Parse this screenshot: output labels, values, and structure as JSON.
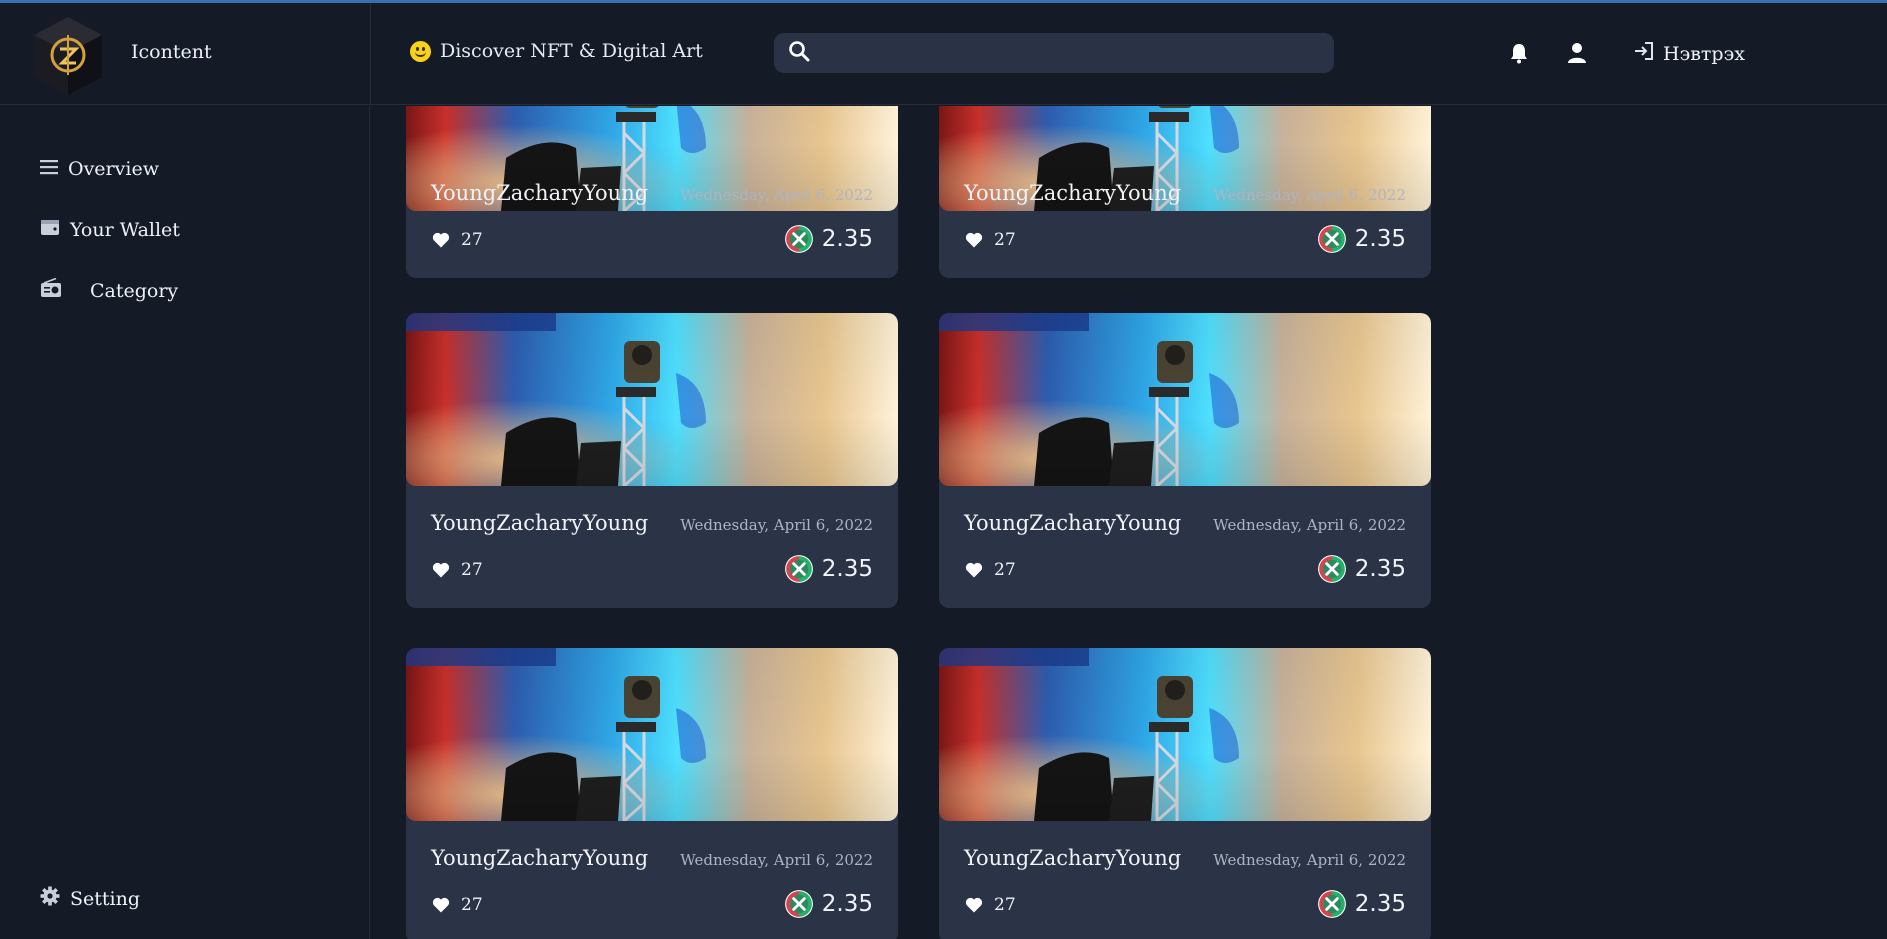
{
  "app": {
    "name": "Icontent",
    "tagline": "Discover NFT & Digital Art"
  },
  "header": {
    "search_placeholder": "",
    "icons": [
      "bell-icon",
      "user-icon"
    ],
    "login_label": "Нэвтрэх"
  },
  "sidebar": {
    "items": [
      {
        "label": "Overview",
        "icon": "list-icon"
      },
      {
        "label": "Your Wallet",
        "icon": "wallet-icon"
      },
      {
        "label": "Category",
        "icon": "radio-icon"
      }
    ],
    "footer": {
      "label": "Setting",
      "icon": "gear-icon"
    }
  },
  "cards": [
    {
      "author": "YoungZacharyYoung",
      "date": "Wednesday, April 6, 2022",
      "likes": "27",
      "price": "2.35"
    },
    {
      "author": "YoungZacharyYoung",
      "date": "Wednesday, April 6, 2022",
      "likes": "27",
      "price": "2.35"
    },
    {
      "author": "YoungZacharyYoung",
      "date": "Wednesday, April 6, 2022",
      "likes": "27",
      "price": "2.35"
    },
    {
      "author": "YoungZacharyYoung",
      "date": "Wednesday, April 6, 2022",
      "likes": "27",
      "price": "2.35"
    },
    {
      "author": "YoungZacharyYoung",
      "date": "Wednesday, April 6, 2022",
      "likes": "27",
      "price": "2.35"
    },
    {
      "author": "YoungZacharyYoung",
      "date": "Wednesday, April 6, 2022",
      "likes": "27",
      "price": "2.35"
    }
  ],
  "colors": {
    "background": "#151a27",
    "card": "#2b3347",
    "accent": "#3a6fb0",
    "coin_red": "#d9434f",
    "coin_green": "#23b26b"
  }
}
